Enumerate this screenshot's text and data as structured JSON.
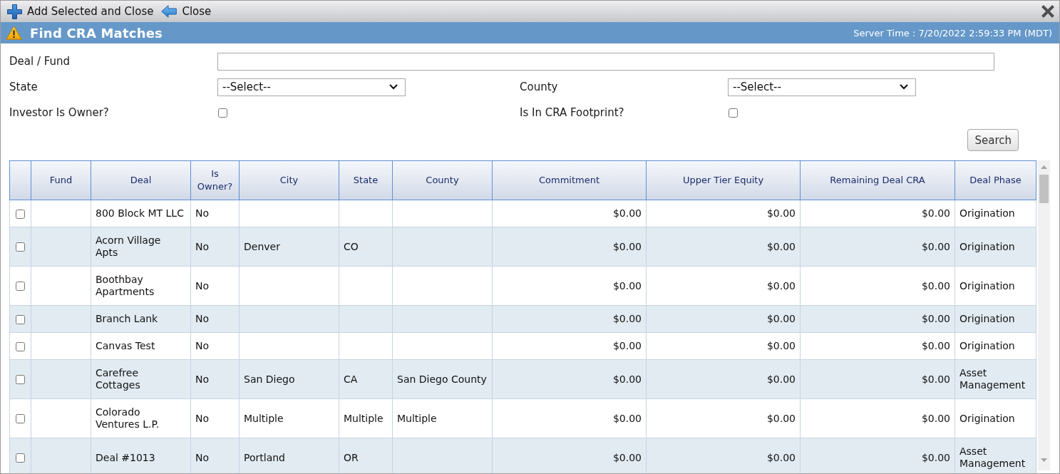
{
  "toolbar": {
    "buttons": [
      {
        "kind": "add",
        "label": "Add Selected and Close"
      },
      {
        "kind": "back",
        "label": "Close"
      }
    ]
  },
  "title_bar": {
    "title": "Find CRA Matches",
    "server_time": "Server Time : 7/20/2022 2:59:33 PM (MDT)"
  },
  "filter_rows": [
    {
      "fields": [
        {
          "kind": "text",
          "label": "Deal / Fund"
        }
      ]
    },
    {
      "fields": [
        {
          "kind": "select",
          "label": "State",
          "value": "--Select--"
        },
        {
          "kind": "select",
          "label": "County",
          "value": "--Select--"
        }
      ]
    },
    {
      "fields": [
        {
          "kind": "checkbox",
          "label": "Investor Is Owner?",
          "checked": false
        },
        {
          "kind": "checkbox",
          "label": "Is In CRA Footprint?",
          "checked": false
        }
      ]
    }
  ],
  "search_button": "Search",
  "table": {
    "columns": [
      "Fund",
      "Deal",
      "Is Owner?",
      "City",
      "State",
      "County",
      "Commitment",
      "Upper Tier Equity",
      "Remaining Deal CRA",
      "Deal Phase"
    ],
    "rows": [
      {
        "checked": false,
        "cells": [
          null,
          "800 Block MT LLC",
          "No",
          null,
          null,
          null,
          "$0.00",
          "$0.00",
          "$0.00",
          "Origination"
        ]
      },
      {
        "checked": false,
        "cells": [
          null,
          "Acorn Village Apts",
          "No",
          "Denver",
          "CO",
          null,
          "$0.00",
          "$0.00",
          "$0.00",
          "Origination"
        ]
      },
      {
        "checked": false,
        "cells": [
          null,
          "Boothbay Apartments",
          "No",
          null,
          null,
          null,
          "$0.00",
          "$0.00",
          "$0.00",
          "Origination"
        ]
      },
      {
        "checked": false,
        "cells": [
          null,
          "Branch Lank",
          "No",
          null,
          null,
          null,
          "$0.00",
          "$0.00",
          "$0.00",
          "Origination"
        ]
      },
      {
        "checked": false,
        "cells": [
          null,
          "Canvas Test",
          "No",
          null,
          null,
          null,
          "$0.00",
          "$0.00",
          "$0.00",
          "Origination"
        ]
      },
      {
        "checked": false,
        "cells": [
          null,
          "Carefree Cottages",
          "No",
          "San Diego",
          "CA",
          "San Diego County",
          "$0.00",
          "$0.00",
          "$0.00",
          "Asset Management"
        ]
      },
      {
        "checked": false,
        "cells": [
          null,
          "Colorado Ventures L.P.",
          "No",
          "Multiple",
          "Multiple",
          "Multiple",
          "$0.00",
          "$0.00",
          "$0.00",
          "Origination"
        ]
      },
      {
        "checked": false,
        "cells": [
          null,
          "Deal #1013",
          "No",
          "Portland",
          "OR",
          null,
          "$0.00",
          "$0.00",
          "$0.00",
          "Asset Management"
        ]
      }
    ]
  }
}
